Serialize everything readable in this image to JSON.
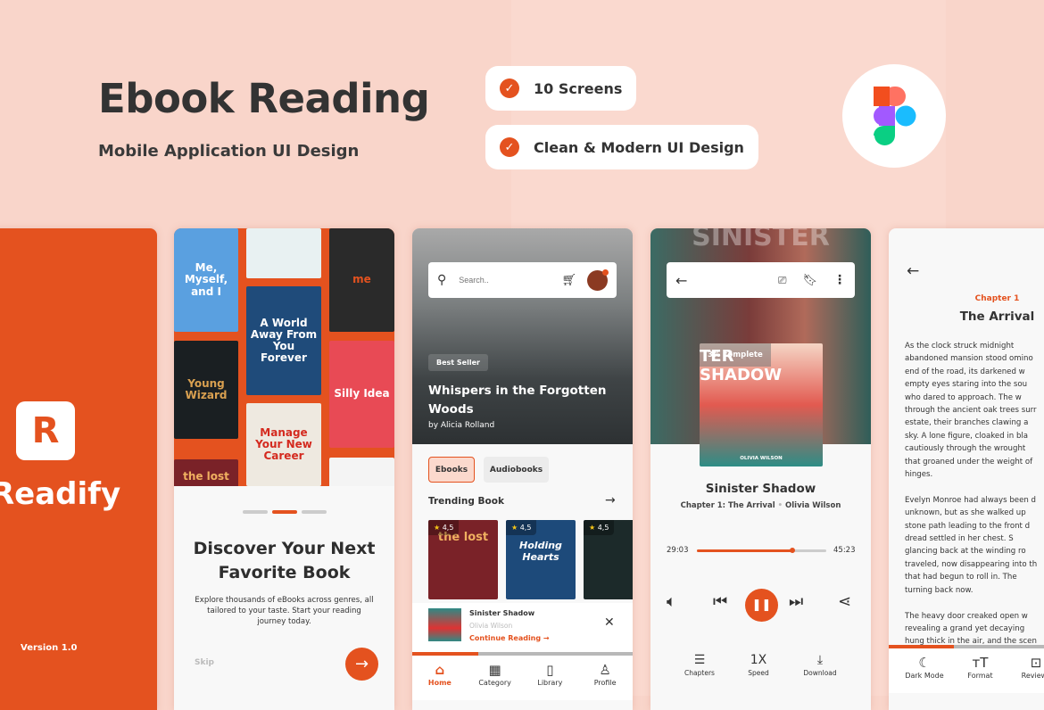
{
  "colors": {
    "accent": "#e4521f",
    "background": "#f9d5ca"
  },
  "header": {
    "title": "Ebook Reading",
    "subtitle": "Mobile Application UI Design",
    "features": [
      "10 Screens",
      "Clean & Modern UI Design"
    ],
    "figma_icon": "figma-logo"
  },
  "splash": {
    "brand": "Readify",
    "version": "Version 1.0"
  },
  "onboarding": {
    "covers": [
      "Me, Myself, and I",
      "",
      "me",
      "A World Away From You Forever",
      "Young Wizard",
      "Manage Your New Career",
      "Silly Idea",
      "the lost",
      ""
    ],
    "title": "Discover Your Next Favorite Book",
    "text": "Explore thousands of eBooks across genres, all tailored to your taste. Start your reading journey today.",
    "skip": "Skip",
    "active_page": 2,
    "page_count": 3
  },
  "home": {
    "search_placeholder": "Search..",
    "badge": "Best Seller",
    "hero_title": "Whispers in the Forgotten Woods",
    "hero_author": "by Alicia Rolland",
    "tabs": [
      "Ebooks",
      "Audiobooks"
    ],
    "section": "Trending Book",
    "books": [
      {
        "title": "the lost",
        "rating": "4,5"
      },
      {
        "title": "Holding Hearts",
        "rating": "4,5"
      },
      {
        "title": "",
        "rating": "4,5"
      }
    ],
    "mini": {
      "title": "Sinister Shadow",
      "author": "Olivia Wilson",
      "action": "Continue Reading",
      "progress": 0.3
    },
    "nav": [
      {
        "label": "Home",
        "icon": "home-icon",
        "active": true
      },
      {
        "label": "Category",
        "icon": "grid-icon"
      },
      {
        "label": "Library",
        "icon": "book-icon"
      },
      {
        "label": "Profile",
        "icon": "user-icon"
      }
    ]
  },
  "player": {
    "cover_title": "TER SHADOW",
    "bg_title": "SINISTER",
    "complete": "3% complete",
    "cover_author": "OLIVIA WILSON",
    "title": "Sinister Shadow",
    "chapter": "Chapter 1: The Arrival",
    "author": "Olivia Wilson",
    "elapsed": "29:03",
    "total": "45:23",
    "progress": 0.74,
    "options": [
      {
        "label": "Chapters",
        "icon": "list-icon"
      },
      {
        "label": "Speed",
        "value": "1X"
      },
      {
        "label": "Download",
        "icon": "download-icon"
      }
    ]
  },
  "reader": {
    "chapter": "Chapter 1",
    "title": "The Arrival",
    "progress": 0.3,
    "paragraphs": [
      [
        "As the clock struck midnight",
        "abandoned mansion stood omino",
        "end of the road, its darkened w",
        "empty eyes staring into the sou",
        "who dared to approach. The w",
        "through the ancient oak trees surr",
        "estate, their branches clawing a",
        "sky. A lone figure, cloaked in bla",
        "cautiously through the wrought",
        "that groaned under the weight of",
        "hinges."
      ],
      [
        "Evelyn Monroe had always been d",
        "unknown, but as she walked up",
        "stone path leading to the front d",
        "dread settled in her chest. S",
        "glancing back at the winding ro",
        "traveled, now disappearing into th",
        "that had begun to roll in. The",
        "turning back now."
      ],
      [
        "The heavy door creaked open w",
        "revealing a grand yet decaying",
        "hung thick in the air, and the scen"
      ]
    ],
    "nav": [
      {
        "label": "Dark Mode",
        "icon": "moon-icon"
      },
      {
        "label": "Format",
        "icon": "text-size-icon"
      },
      {
        "label": "Reviews",
        "icon": "review-icon"
      }
    ]
  }
}
